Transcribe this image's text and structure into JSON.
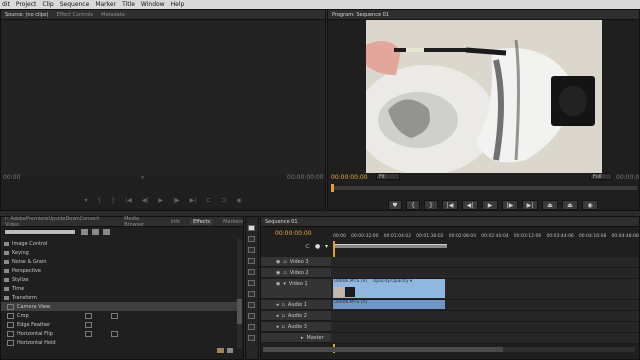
{
  "menu": [
    "dit",
    "Project",
    "Clip",
    "Sequence",
    "Marker",
    "Title",
    "Window",
    "Help"
  ],
  "source_panel": {
    "tabs": [
      "Source: (no clips)",
      "Effect Controls",
      "Metadata"
    ],
    "timecode_left": "00:00",
    "timecode_right": "00:00:00:00"
  },
  "program_panel": {
    "title": "Program: Sequence 01",
    "timecode": "00:00:00:00",
    "fit": "Fit",
    "quality": "Full",
    "timecode_right": "00:00:0"
  },
  "effects_panel": {
    "tabs": [
      "r: AdobePremiereUpsideDownConvert Video",
      "Media Browser",
      "Info",
      "Effects",
      "Markers"
    ],
    "active_tab": "Effects",
    "items": [
      {
        "label": "Image Control",
        "kind": "folder",
        "expanded": false
      },
      {
        "label": "Keying",
        "kind": "folder",
        "expanded": false
      },
      {
        "label": "Noise & Grain",
        "kind": "folder",
        "expanded": false
      },
      {
        "label": "Perspective",
        "kind": "folder",
        "expanded": false
      },
      {
        "label": "Stylize",
        "kind": "folder",
        "expanded": false
      },
      {
        "label": "Time",
        "kind": "folder",
        "expanded": false
      },
      {
        "label": "Transform",
        "kind": "folder",
        "expanded": true
      },
      {
        "label": "Camera View",
        "kind": "effect",
        "selected": true
      },
      {
        "label": "Crop",
        "kind": "effect"
      },
      {
        "label": "Edge Feather",
        "kind": "effect"
      },
      {
        "label": "Horizontal Flip",
        "kind": "effect"
      },
      {
        "label": "Horizontal Hold",
        "kind": "effect"
      }
    ]
  },
  "timeline": {
    "tab": "Sequence 01",
    "timecode": "00:00:00:00",
    "ruler": [
      "00:00",
      "00:00:32:00",
      "00:01:04:02",
      "00:01:36:02",
      "00:02:08:04",
      "00:02:40:04",
      "00:03:12:06",
      "00:03:44:06",
      "00:04:16:08",
      "00:04:48:08"
    ],
    "tracks": [
      {
        "name": "Video 3",
        "type": "video"
      },
      {
        "name": "Video 2",
        "type": "video"
      },
      {
        "name": "Video 1",
        "type": "video",
        "expanded": true
      },
      {
        "name": "Audio 1",
        "type": "audio"
      },
      {
        "name": "Audio 2",
        "type": "audio"
      },
      {
        "name": "Audio 3",
        "type": "audio"
      },
      {
        "name": "Master",
        "type": "master"
      }
    ],
    "video_clip_label": "00006.MTS [V]",
    "video_clip_effect": "Opacity:Opacity ▾",
    "audio_clip_label": "00006.MTS [A]"
  },
  "colors": {
    "timecode": "#e6a93a",
    "clip_video": "#8fb7e0",
    "clip_audio": "#6e96c8",
    "playhead": "#e0a030"
  }
}
